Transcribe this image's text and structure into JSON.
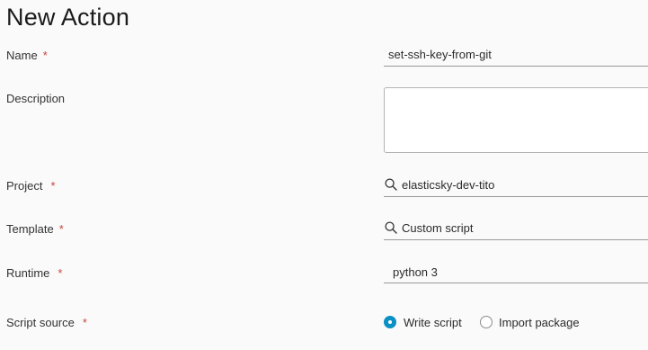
{
  "page": {
    "title": "New Action"
  },
  "form": {
    "required_marker": "*",
    "name": {
      "label": "Name",
      "value": "set-ssh-key-from-git"
    },
    "description": {
      "label": "Description",
      "value": ""
    },
    "project": {
      "label": "Project",
      "value": "elasticsky-dev-tito",
      "icon": "search-icon"
    },
    "template": {
      "label": "Template",
      "value": "Custom script",
      "icon": "search-icon"
    },
    "runtime": {
      "label": "Runtime",
      "value": "python 3"
    },
    "script_source": {
      "label": "Script source",
      "options": [
        {
          "label": "Write script",
          "selected": true
        },
        {
          "label": "Import package",
          "selected": false
        }
      ]
    }
  },
  "colors": {
    "accent": "#0b90c4",
    "required": "#c9443e"
  }
}
